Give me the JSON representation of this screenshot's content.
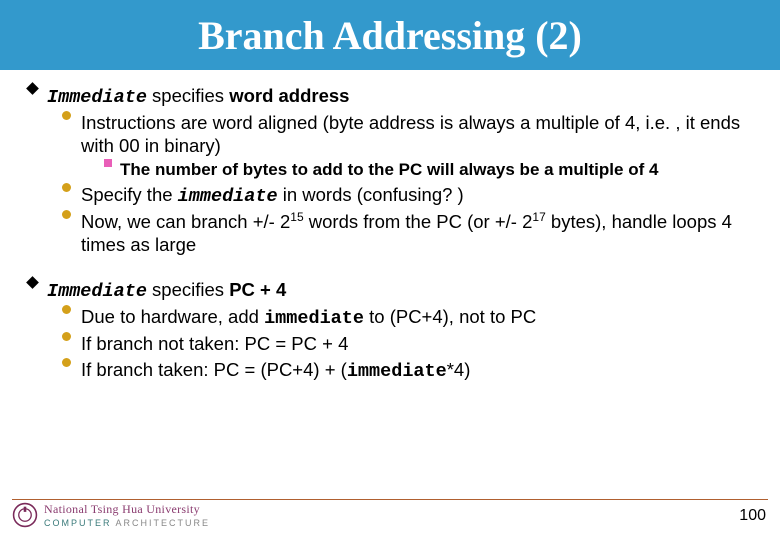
{
  "title": "Branch Addressing (2)",
  "section1": {
    "head_pre": "Immediate",
    "head_post": " specifies ",
    "head_bold": "word address",
    "b1": "Instructions are word aligned (byte address is always a multiple of 4, i.e. , it ends with 00 in binary)",
    "b1a": "The number of bytes to add to the PC will always be a multiple of 4",
    "b2_pre": "Specify the ",
    "b2_imm": "immediate",
    "b2_post": " in words (confusing? )",
    "b3_a": "Now, we can branch +/- 2",
    "b3_b": " words from the PC (or +/- 2",
    "b3_c": " bytes), handle loops 4 times as large",
    "b3_sup1": "15",
    "b3_sup2": "17"
  },
  "section2": {
    "head_pre": "Immediate",
    "head_post": " specifies ",
    "head_bold": "PC + 4",
    "b1_pre": "Due to hardware, add ",
    "b1_imm": "immediate",
    "b1_post": " to (PC+4), not to PC",
    "b2": "If branch not taken: PC = PC + 4",
    "b3_pre": "If branch taken: PC = (PC+4) + (",
    "b3_imm": "immediate",
    "b3_post": "*4)"
  },
  "footer": {
    "university": "National Tsing Hua University",
    "lab1": "COMPUTER",
    "lab2": "ARCHITECTURE",
    "slide": "100"
  }
}
